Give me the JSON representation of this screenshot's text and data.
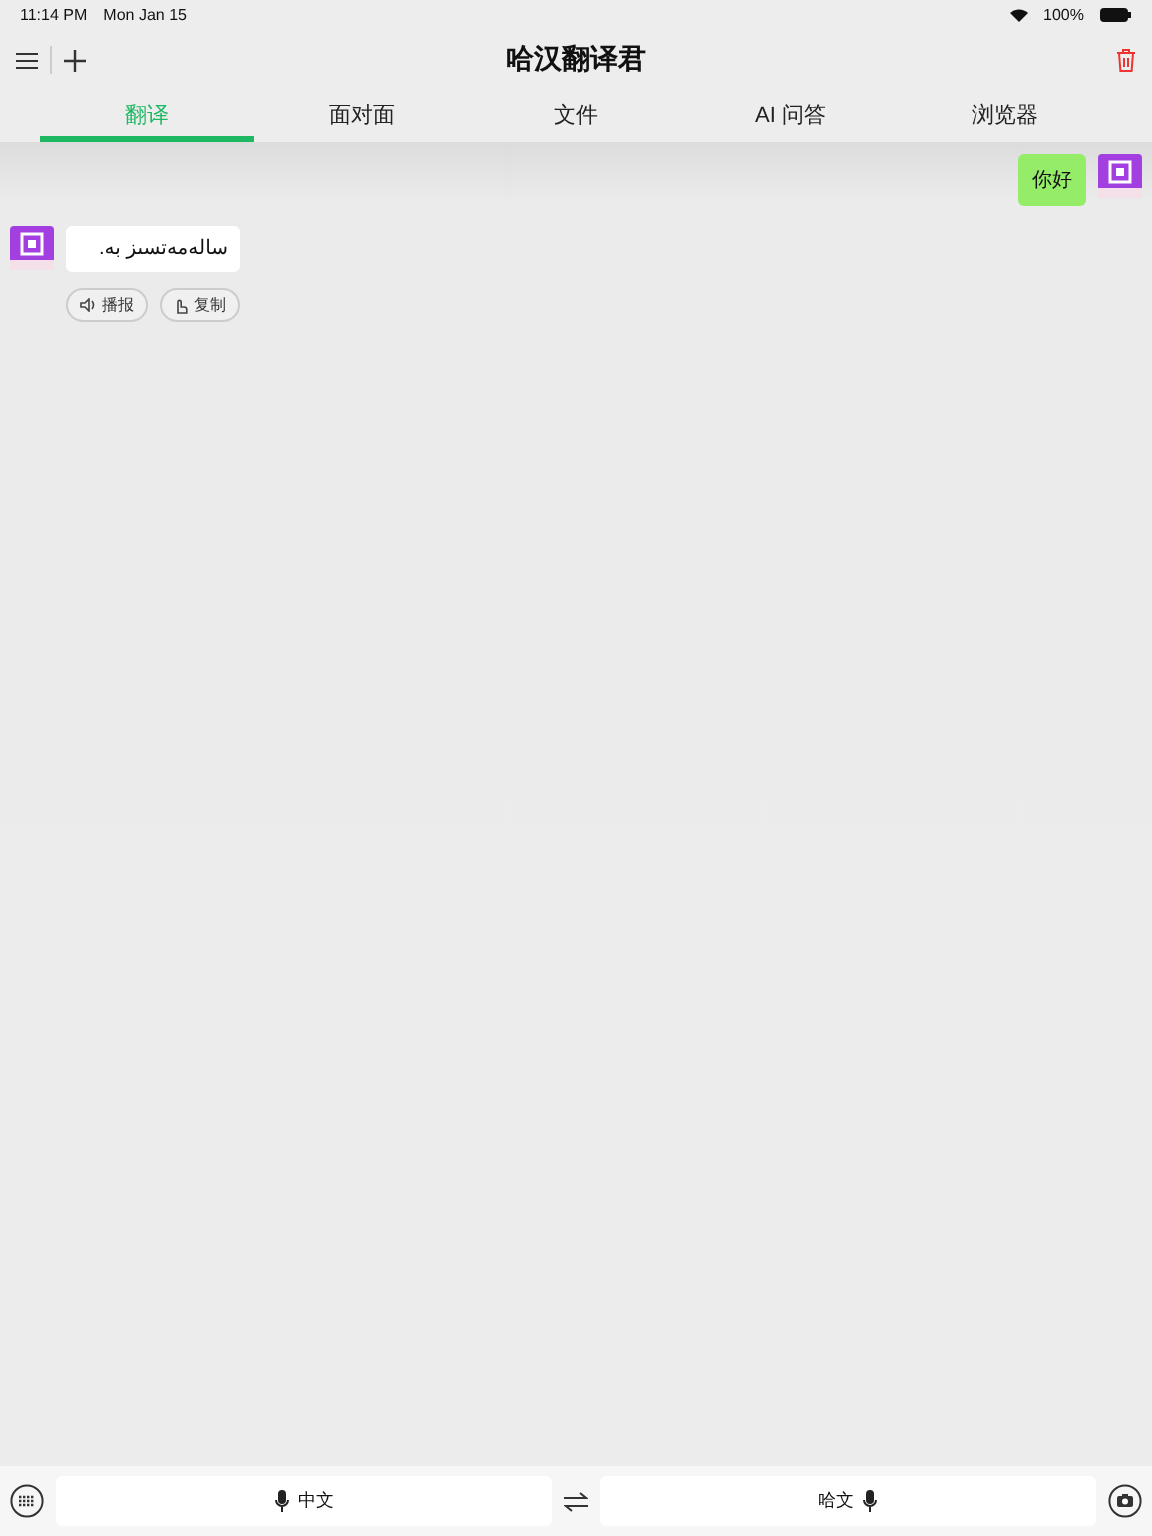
{
  "status_bar": {
    "time": "11:14 PM",
    "date": "Mon Jan 15",
    "battery": "100%"
  },
  "header": {
    "title": "哈汉翻译君"
  },
  "tabs": [
    {
      "label": "翻译",
      "selected": true
    },
    {
      "label": "面对面",
      "selected": false
    },
    {
      "label": "文件",
      "selected": false
    },
    {
      "label": "AI 问答",
      "selected": false
    },
    {
      "label": "浏览器",
      "selected": false
    }
  ],
  "messages": [
    {
      "kind": "sent",
      "text": "你好"
    },
    {
      "kind": "received",
      "text": "سالەمەتسىز بە.",
      "actions": [
        "播报",
        "复制"
      ]
    }
  ],
  "bottom_bar": {
    "source_language": "中文",
    "target_language": "哈文"
  }
}
